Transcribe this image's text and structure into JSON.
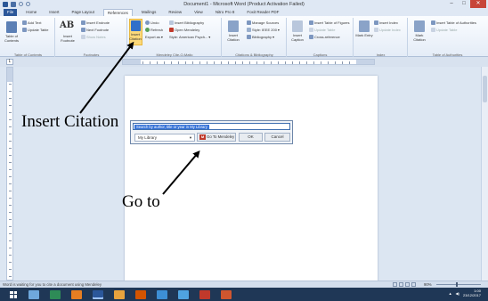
{
  "window": {
    "title": "Document1 - Microsoft Word (Product Activation Failed)",
    "minimize": "–",
    "maximize": "□",
    "close": "✕"
  },
  "tabs": [
    "File",
    "Home",
    "Insert",
    "Page Layout",
    "References",
    "Mailings",
    "Review",
    "View",
    "Nitro Pro 8",
    "Foxit Reader PDF"
  ],
  "active_tab": "References",
  "ribbon": {
    "toc": {
      "table_of_contents": "Table of Contents",
      "add_text": "Add Text",
      "update_table": "Update Table",
      "group": "Table of Contents"
    },
    "footnotes": {
      "insert_footnote": "Insert Footnote",
      "insert_endnote": "Insert Endnote",
      "next_footnote": "Next Footnote",
      "show_notes": "Show Notes",
      "group": "Footnotes"
    },
    "mendeley": {
      "insert_citation": "Insert Citation",
      "undo": "Undo",
      "refresh": "Refresh",
      "export_as": "Export as",
      "insert_bibliography": "Insert Bibliography",
      "open_mendeley": "Open Mendeley",
      "style_label": "Style:",
      "style_value": "American Psych...",
      "group": "Mendeley Cite-O-Matic"
    },
    "citations": {
      "insert_citation": "Insert Citation",
      "manage_sources": "Manage Sources",
      "style_label": "Style:",
      "style_value": "IEEE 200",
      "bibliography": "Bibliography",
      "group": "Citations & Bibliography"
    },
    "captions": {
      "insert_caption": "Insert Caption",
      "insert_table_of_figures": "Insert Table of Figures",
      "update_table": "Update Table",
      "cross_reference": "Cross-reference",
      "group": "Captions"
    },
    "index": {
      "mark_entry": "Mark Entry",
      "insert_index": "Insert Index",
      "update_index": "Update Index",
      "group": "Index"
    },
    "authorities": {
      "mark_citation": "Mark Citation",
      "insert_table_of_authorities": "Insert Table of Authorities",
      "update_table": "Update Table",
      "group": "Table of Authorities"
    }
  },
  "citation_popup": {
    "search_text": "Search by author, title or year in My Library",
    "library": "My Library",
    "goto_button": "Go To Mendeley",
    "ok_button": "OK",
    "cancel_button": "Cancel"
  },
  "status": {
    "text": "Word is waiting for you to cite a document using Mendeley",
    "zoom": "90%"
  },
  "taskbar": {
    "clock_time": "1:00",
    "clock_date": "23/12/2017"
  },
  "annotations": {
    "insert_citation": "Insert Citation",
    "go_to": "Go to"
  },
  "colors": {
    "file_tab": "#2b579a",
    "selection": "#3874d8",
    "taskbar": "#1f3756",
    "mendeley_red": "#c0392b"
  }
}
